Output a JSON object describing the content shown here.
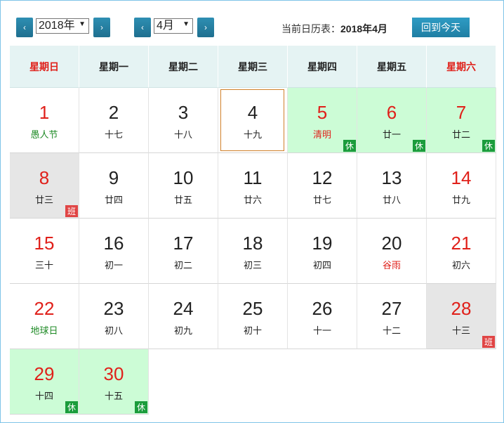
{
  "toolbar": {
    "prev_year_icon": "‹",
    "year": "2018年",
    "next_year_icon": "›",
    "prev_month_icon": "‹",
    "month": "4月",
    "next_month_icon": "›",
    "current_label": "当前日历表：",
    "current_value": "2018年4月",
    "today_button": "回到今天"
  },
  "weekdays": [
    "星期日",
    "星期一",
    "星期二",
    "星期三",
    "星期四",
    "星期五",
    "星期六"
  ],
  "days": [
    {
      "day": "1",
      "lunar": "愚人节",
      "day_color": "red",
      "lunar_color": "green"
    },
    {
      "day": "2",
      "lunar": "十七"
    },
    {
      "day": "3",
      "lunar": "十八"
    },
    {
      "day": "4",
      "lunar": "十九",
      "today": true
    },
    {
      "day": "5",
      "lunar": "清明",
      "day_color": "red",
      "lunar_color": "red",
      "status": "holiday",
      "tag": "休"
    },
    {
      "day": "6",
      "lunar": "廿一",
      "day_color": "red",
      "status": "holiday",
      "tag": "休"
    },
    {
      "day": "7",
      "lunar": "廿二",
      "day_color": "red",
      "status": "holiday",
      "tag": "休"
    },
    {
      "day": "8",
      "lunar": "廿三",
      "day_color": "red",
      "status": "workday",
      "tag": "班"
    },
    {
      "day": "9",
      "lunar": "廿四"
    },
    {
      "day": "10",
      "lunar": "廿五"
    },
    {
      "day": "11",
      "lunar": "廿六"
    },
    {
      "day": "12",
      "lunar": "廿七"
    },
    {
      "day": "13",
      "lunar": "廿八"
    },
    {
      "day": "14",
      "lunar": "廿九",
      "day_color": "red"
    },
    {
      "day": "15",
      "lunar": "三十",
      "day_color": "red"
    },
    {
      "day": "16",
      "lunar": "初一"
    },
    {
      "day": "17",
      "lunar": "初二"
    },
    {
      "day": "18",
      "lunar": "初三"
    },
    {
      "day": "19",
      "lunar": "初四"
    },
    {
      "day": "20",
      "lunar": "谷雨",
      "lunar_color": "red"
    },
    {
      "day": "21",
      "lunar": "初六",
      "day_color": "red"
    },
    {
      "day": "22",
      "lunar": "地球日",
      "day_color": "red",
      "lunar_color": "green"
    },
    {
      "day": "23",
      "lunar": "初八"
    },
    {
      "day": "24",
      "lunar": "初九"
    },
    {
      "day": "25",
      "lunar": "初十"
    },
    {
      "day": "26",
      "lunar": "十一"
    },
    {
      "day": "27",
      "lunar": "十二"
    },
    {
      "day": "28",
      "lunar": "十三",
      "day_color": "red",
      "status": "workday",
      "tag": "班"
    },
    {
      "day": "29",
      "lunar": "十四",
      "day_color": "red",
      "status": "holiday",
      "tag": "休"
    },
    {
      "day": "30",
      "lunar": "十五",
      "day_color": "red",
      "status": "holiday",
      "tag": "休"
    }
  ],
  "colors": {
    "red": "#e0201a",
    "green": "#1e8a25",
    "holiday_bg": "#ccfcd6",
    "workday_bg": "#e6e6e6",
    "rest_tag": "#1b9c3c",
    "work_tag": "#e04545"
  }
}
